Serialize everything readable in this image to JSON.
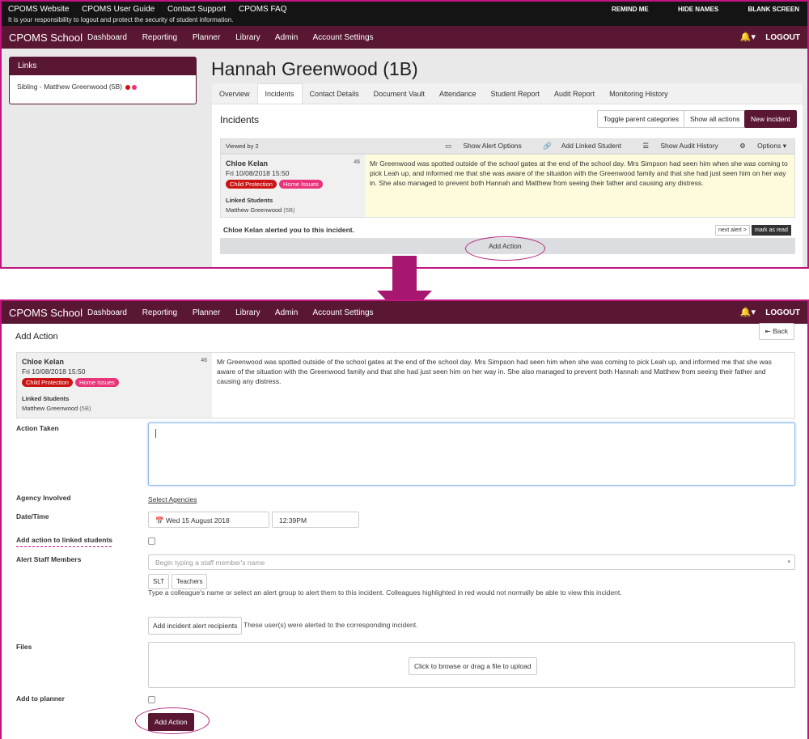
{
  "colors": {
    "brand": "#5a1733",
    "accent": "#c0147f",
    "child_protection": "#cc1414",
    "home_issues": "#e9337a",
    "alert_bg": "#fefbdc"
  },
  "topbar": {
    "links": [
      "CPOMS Website",
      "CPOMS User Guide",
      "Contact Support",
      "CPOMS FAQ"
    ],
    "notice": "It is your responsibility to logout and protect the security of student information.",
    "right": [
      "REMIND ME",
      "HIDE NAMES",
      "BLANK SCREEN"
    ]
  },
  "navbar": {
    "brand": "CPOMS School",
    "menu": [
      "Dashboard",
      "Reporting",
      "Planner",
      "Library",
      "Admin",
      "Account Settings"
    ],
    "bell_icon": "bell-icon",
    "bell_caret": "▾",
    "logout": "LOGOUT"
  },
  "links_box": {
    "title": "Links",
    "prefix": "Sibling - ",
    "name": "Matthew Greenwood",
    "form": "(5B)"
  },
  "student": {
    "name": "Hannah Greenwood",
    "form": "(1B)"
  },
  "tabs": [
    "Overview",
    "Incidents",
    "Contact Details",
    "Document Vault",
    "Attendance",
    "Student Report",
    "Audit Report",
    "Monitoring History"
  ],
  "incidents": {
    "title": "Incidents",
    "toggle_btn": "Toggle parent categories",
    "show_all_btn": "Show all actions",
    "new_btn": "New incident",
    "viewed": "Viewed by 2",
    "options": [
      "Show Alert Options",
      "Add Linked Student",
      "Show Audit History",
      "Options"
    ],
    "alert_line": "Chloe Kelan alerted you to this incident.",
    "next_alert": "next alert >",
    "mark_read": "mark as read",
    "add_action": "Add Action"
  },
  "incident": {
    "author": "Chloe Kelan",
    "date": "Fri 10/08/2018 15:50",
    "count": "46",
    "tags": [
      "Child Protection",
      "Home Issues"
    ],
    "linked_label": "Linked Students",
    "linked_name": "Matthew Greenwood",
    "linked_form": "(5B)",
    "text": "Mr Greenwood was spotted outside of the school gates at the end of the school day. Mrs Simpson had seen him when she was coming to pick Leah up, and informed me that she was aware of the situation with the Greenwood family and that she had just seen him on her way in. She also managed to prevent both Hannah and Matthew from seeing their father and causing any distress."
  },
  "add_action_form": {
    "title": "Add Action",
    "back": "Back",
    "labels": {
      "action_taken": "Action Taken",
      "agency": "Agency Involved",
      "datetime": "Date/Time",
      "linked": "Add action to linked students",
      "alert_staff": "Alert Staff Members",
      "files": "Files",
      "planner": "Add to planner"
    },
    "select_agencies": "Select Agencies",
    "date_value": "Wed 15 August 2018",
    "time_value": "12:39PM",
    "staff_placeholder": "Begin typing a staff member's name",
    "groups": [
      "SLT",
      "Teachers"
    ],
    "help": "Type a colleague's name or select an alert group to alert them to this incident. Colleagues highlighted in red would not normally be able to view this incident.",
    "recipients_btn": "Add incident alert recipients",
    "recipients_text": "These user(s) were alerted to the corresponding incident.",
    "upload": "Click to browse or drag a file to upload",
    "submit": "Add Action"
  }
}
